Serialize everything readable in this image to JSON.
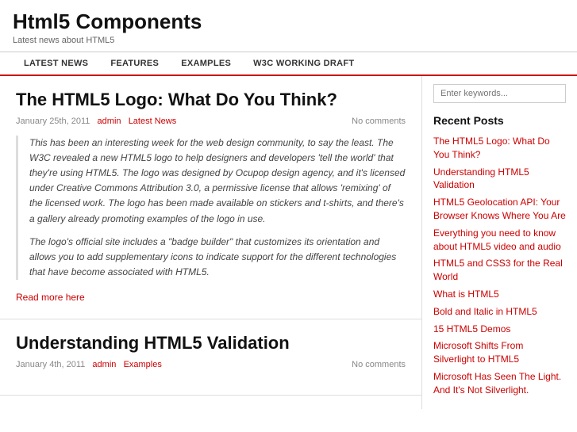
{
  "header": {
    "title": "Html5 Components",
    "subtitle": "Latest news about HTML5"
  },
  "nav": {
    "items": [
      {
        "label": "LATEST NEWS",
        "id": "nav-latest-news"
      },
      {
        "label": "FEATURES",
        "id": "nav-features"
      },
      {
        "label": "EXAMPLES",
        "id": "nav-examples"
      },
      {
        "label": "W3C WORKING DRAFT",
        "id": "nav-w3c"
      }
    ]
  },
  "articles": [
    {
      "title": "The HTML5 Logo: What Do You Think?",
      "date": "January 25th, 2011",
      "author": "admin",
      "category": "Latest News",
      "comments": "No comments",
      "body1": "This has been an interesting week for the web design community, to say the least. The W3C revealed a new HTML5 logo to help designers and developers 'tell the world' that they're using HTML5. The logo was designed by Ocupop design agency, and it's licensed under Creative Commons Attribution 3.0, a permissive license that allows 'remixing' of the licensed work. The logo has been made available on stickers and t-shirts, and there's a gallery already promoting examples of the logo in use.",
      "body2": "The logo's official site includes a \"badge builder\" that customizes its orientation and allows you to add supplementary icons to indicate support for the different technologies that have become associated with HTML5.",
      "read_more": "Read more here"
    },
    {
      "title": "Understanding HTML5 Validation",
      "date": "January 4th, 2011",
      "author": "admin",
      "category": "Examples",
      "comments": "No comments",
      "body1": "",
      "body2": "",
      "read_more": ""
    }
  ],
  "sidebar": {
    "search_placeholder": "Enter keywords...",
    "recent_posts_title": "Recent Posts",
    "recent_posts": [
      {
        "title": "The HTML5 Logo: What Do You Think?"
      },
      {
        "title": "Understanding HTML5 Validation"
      },
      {
        "title": "HTML5 Geolocation API: Your Browser Knows Where You Are"
      },
      {
        "title": "Everything you need to know about HTML5 video and audio"
      },
      {
        "title": "HTML5 and CSS3 for the Real World"
      },
      {
        "title": "What is HTML5"
      },
      {
        "title": "Bold and Italic in HTML5"
      },
      {
        "title": "15 HTML5 Demos"
      },
      {
        "title": "Microsoft Shifts From Silverlight to HTML5"
      },
      {
        "title": "Microsoft Has Seen The Light. And It's Not Silverlight."
      }
    ]
  }
}
